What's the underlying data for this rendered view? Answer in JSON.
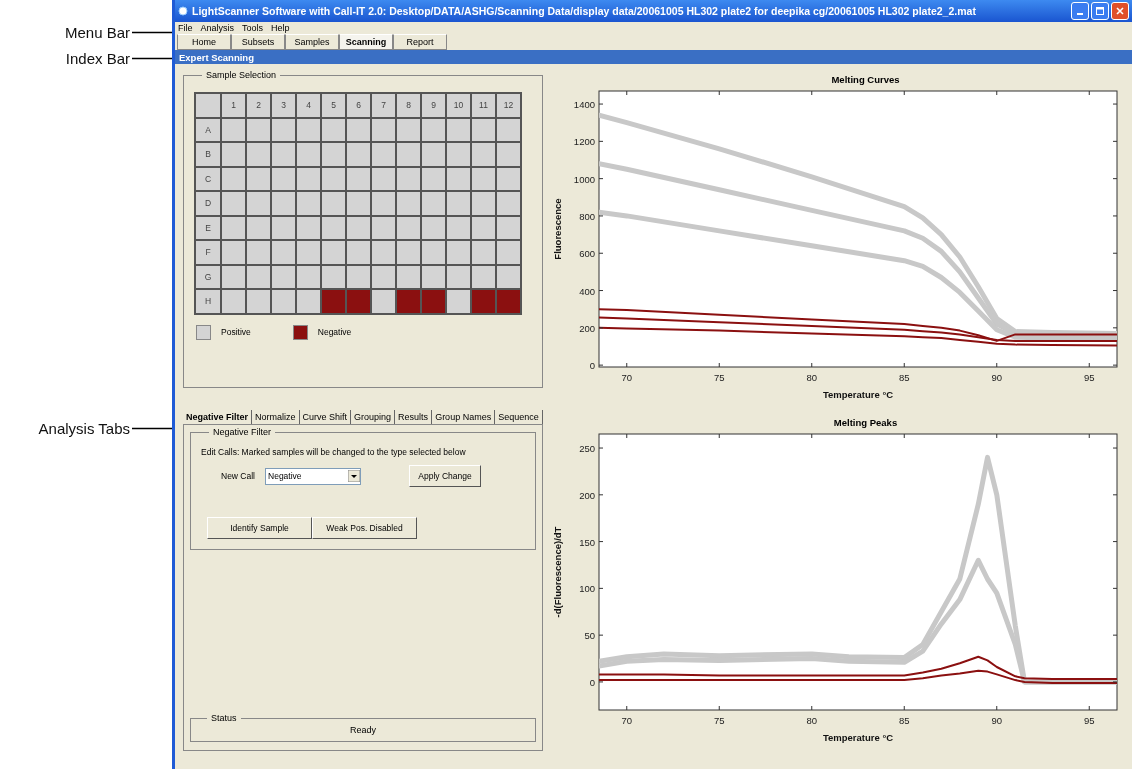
{
  "annotations": [
    {
      "label": "Menu Bar"
    },
    {
      "label": "Index Bar"
    },
    {
      "label": "Analysis Tabs"
    }
  ],
  "window": {
    "title": "LightScanner Software with Call-IT 2.0: Desktop/DATA/ASHG/Scanning Data/display data/20061005 HL302 plate2 for deepika  cg/20061005 HL302 plate2_2.mat"
  },
  "menu": [
    "File",
    "Analysis",
    "Tools",
    "Help"
  ],
  "index_tabs": [
    {
      "label": "Home",
      "selected": false
    },
    {
      "label": "Subsets",
      "selected": false
    },
    {
      "label": "Samples",
      "selected": false
    },
    {
      "label": "Scanning",
      "selected": true
    },
    {
      "label": "Report",
      "selected": false
    }
  ],
  "section_title": "Expert Scanning",
  "sample_selection": {
    "title": "Sample Selection",
    "columns": [
      "1",
      "2",
      "3",
      "4",
      "5",
      "6",
      "7",
      "8",
      "9",
      "10",
      "11",
      "12"
    ],
    "rows": [
      {
        "label": "A",
        "negative": [
          false,
          false,
          false,
          false,
          false,
          false,
          false,
          false,
          false,
          false,
          false,
          false
        ]
      },
      {
        "label": "B",
        "negative": [
          false,
          false,
          false,
          false,
          false,
          false,
          false,
          false,
          false,
          false,
          false,
          false
        ]
      },
      {
        "label": "C",
        "negative": [
          false,
          false,
          false,
          false,
          false,
          false,
          false,
          false,
          false,
          false,
          false,
          false
        ]
      },
      {
        "label": "D",
        "negative": [
          false,
          false,
          false,
          false,
          false,
          false,
          false,
          false,
          false,
          false,
          false,
          false
        ]
      },
      {
        "label": "E",
        "negative": [
          false,
          false,
          false,
          false,
          false,
          false,
          false,
          false,
          false,
          false,
          false,
          false
        ]
      },
      {
        "label": "F",
        "negative": [
          false,
          false,
          false,
          false,
          false,
          false,
          false,
          false,
          false,
          false,
          false,
          false
        ]
      },
      {
        "label": "G",
        "negative": [
          false,
          false,
          false,
          false,
          false,
          false,
          false,
          false,
          false,
          false,
          false,
          false
        ]
      },
      {
        "label": "H",
        "negative": [
          false,
          false,
          false,
          false,
          true,
          true,
          false,
          true,
          true,
          false,
          true,
          true
        ]
      }
    ],
    "legend": [
      {
        "label": "Positive",
        "color": "#d4d4d4"
      },
      {
        "label": "Negative",
        "color": "#8b1010"
      }
    ]
  },
  "analysis_tabs": [
    {
      "label": "Negative Filter",
      "selected": true
    },
    {
      "label": "Normalize",
      "selected": false
    },
    {
      "label": "Curve Shift",
      "selected": false
    },
    {
      "label": "Grouping",
      "selected": false
    },
    {
      "label": "Results",
      "selected": false
    },
    {
      "label": "Group Names",
      "selected": false
    },
    {
      "label": "Sequence",
      "selected": false
    }
  ],
  "negative_filter": {
    "title": "Negative Filter",
    "instructions": "Edit Calls: Marked samples will be changed to the type selected below",
    "new_call_label": "New Call",
    "new_call_value": "Negative",
    "apply_button": "Apply Change",
    "buttons": [
      "Identify Sample",
      "Weak Pos. Disabled"
    ]
  },
  "status": {
    "title": "Status",
    "text": "Ready"
  },
  "charts": [
    {
      "chart_data": {
        "type": "line",
        "title": "Melting Curves",
        "xlabel": "Temperature °C",
        "ylabel": "Fluorescence",
        "x": [
          68.5,
          70,
          75,
          80,
          85,
          86,
          87,
          88,
          89,
          90,
          91,
          93,
          96.5
        ],
        "series": [
          {
            "color": "#c8c8c8",
            "values": [
              1340,
              1300,
              1160,
              1010,
              850,
              790,
              700,
              580,
              420,
              250,
              180,
              175,
              170
            ]
          },
          {
            "color": "#c8c8c8",
            "values": [
              1080,
              1050,
              940,
              830,
              720,
              680,
              610,
              500,
              360,
              220,
              170,
              165,
              160
            ]
          },
          {
            "color": "#c8c8c8",
            "values": [
              820,
              800,
              720,
              640,
              560,
              530,
              470,
              390,
              290,
              190,
              150,
              145,
              140
            ]
          },
          {
            "color": "#8b1010",
            "values": [
              300,
              295,
              270,
              245,
              220,
              210,
              200,
              185,
              160,
              130,
              165,
              165,
              165
            ]
          },
          {
            "color": "#8b1010",
            "values": [
              255,
              250,
              230,
              210,
              190,
              182,
              175,
              165,
              150,
              135,
              130,
              130,
              130
            ]
          },
          {
            "color": "#8b1010",
            "values": [
              200,
              197,
              185,
              170,
              155,
              150,
              145,
              135,
              125,
              115,
              110,
              108,
              106
            ]
          }
        ],
        "xlim": [
          68.5,
          96.5
        ],
        "ylim": [
          -10,
          1470
        ],
        "xticks": [
          70,
          75,
          80,
          85,
          90,
          95
        ],
        "yticks": [
          0,
          200,
          400,
          600,
          800,
          1000,
          1200,
          1400
        ]
      }
    },
    {
      "chart_data": {
        "type": "line",
        "title": "Melting Peaks",
        "xlabel": "Temperature °C",
        "ylabel": "-d(Fluorescence)/dT",
        "x": [
          68.5,
          70,
          72,
          75,
          80,
          82,
          85,
          86,
          87,
          88,
          89,
          89.5,
          90,
          91,
          91.5,
          93,
          96.5
        ],
        "series": [
          {
            "color": "#c8c8c8",
            "values": [
              22,
              27,
              30,
              28,
              30,
              27,
              26,
              40,
              75,
              110,
              190,
              240,
              200,
              60,
              0,
              0,
              0
            ]
          },
          {
            "color": "#c8c8c8",
            "values": [
              17,
              22,
              24,
              23,
              25,
              22,
              21,
              33,
              62,
              88,
              130,
              110,
              95,
              40,
              0,
              0,
              0
            ]
          },
          {
            "color": "#8b1010",
            "values": [
              8,
              8,
              8,
              7,
              7,
              7,
              7,
              10,
              14,
              20,
              27,
              23,
              16,
              6,
              4,
              3,
              3
            ]
          },
          {
            "color": "#8b1010",
            "values": [
              2,
              2,
              2,
              2,
              2,
              2,
              2,
              4,
              7,
              9,
              12,
              11,
              8,
              2,
              0,
              -1,
              -1
            ]
          }
        ],
        "xlim": [
          68.5,
          96.5
        ],
        "ylim": [
          -30,
          265
        ],
        "xticks": [
          70,
          75,
          80,
          85,
          90,
          95
        ],
        "yticks": [
          0,
          50,
          100,
          150,
          200,
          250
        ]
      }
    }
  ]
}
